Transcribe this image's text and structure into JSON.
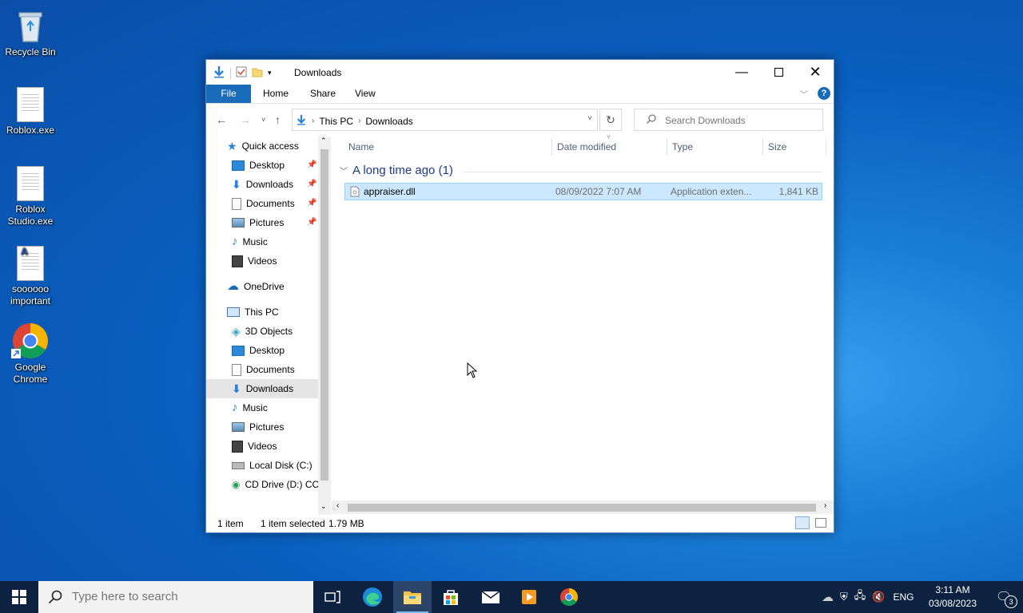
{
  "desktop": {
    "icons": [
      {
        "label": "Recycle Bin"
      },
      {
        "label": "Roblox.exe"
      },
      {
        "label": "Roblox Studio.exe"
      },
      {
        "label": "soooooo important"
      },
      {
        "label": "Google Chrome"
      }
    ]
  },
  "window": {
    "title": "Downloads",
    "ribbon_tabs": [
      "File",
      "Home",
      "Share",
      "View"
    ],
    "address": {
      "segments": [
        "This PC",
        "Downloads"
      ]
    },
    "search": {
      "placeholder": "Search Downloads"
    },
    "nav": {
      "quick_access": "Quick access",
      "quick_items": [
        "Desktop",
        "Downloads",
        "Documents",
        "Pictures",
        "Music",
        "Videos"
      ],
      "onedrive": "OneDrive",
      "this_pc": "This PC",
      "pc_items": [
        "3D Objects",
        "Desktop",
        "Documents",
        "Downloads",
        "Music",
        "Pictures",
        "Videos",
        "Local Disk (C:)",
        "CD Drive (D:) CC"
      ]
    },
    "columns": [
      "Name",
      "Date modified",
      "Type",
      "Size"
    ],
    "group_label": "A long time ago (1)",
    "files": [
      {
        "name": "appraiser.dll",
        "date": "08/09/2022 7:07 AM",
        "type": "Application exten...",
        "size": "1,841 KB"
      }
    ],
    "status": {
      "count": "1 item",
      "selected": "1 item selected",
      "size": "1.79 MB"
    }
  },
  "taskbar": {
    "search_placeholder": "Type here to search",
    "language": "ENG",
    "time": "3:11 AM",
    "date": "03/08/2023",
    "notification_count": "3"
  }
}
